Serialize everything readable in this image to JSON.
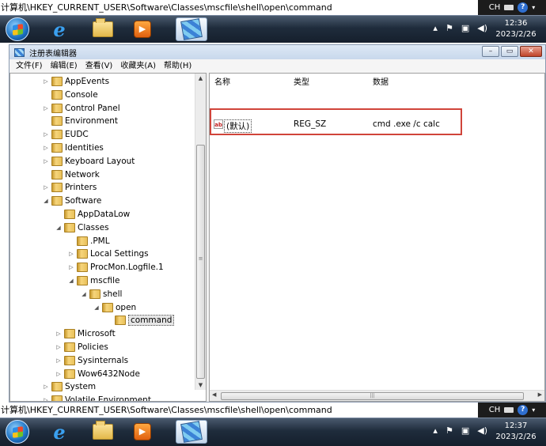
{
  "top": {
    "path": "计算机\\HKEY_CURRENT_USER\\Software\\Classes\\mscfile\\shell\\open\\command",
    "ime": "CH",
    "help": "?",
    "time": "12:36",
    "date": "2023/2/26"
  },
  "bottom": {
    "path": "计算机\\HKEY_CURRENT_USER\\Software\\Classes\\mscfile\\shell\\open\\command",
    "ime": "CH",
    "help": "?",
    "time": "12:37",
    "date": "2023/2/26"
  },
  "window": {
    "title": "注册表编辑器",
    "menu": [
      "文件(F)",
      "编辑(E)",
      "查看(V)",
      "收藏夹(A)",
      "帮助(H)"
    ]
  },
  "tree": [
    {
      "label": "AppEvents",
      "level": 0,
      "exp": "▷"
    },
    {
      "label": "Console",
      "level": 0,
      "exp": ""
    },
    {
      "label": "Control Panel",
      "level": 0,
      "exp": "▷"
    },
    {
      "label": "Environment",
      "level": 0,
      "exp": ""
    },
    {
      "label": "EUDC",
      "level": 0,
      "exp": "▷"
    },
    {
      "label": "Identities",
      "level": 0,
      "exp": "▷"
    },
    {
      "label": "Keyboard Layout",
      "level": 0,
      "exp": "▷"
    },
    {
      "label": "Network",
      "level": 0,
      "exp": ""
    },
    {
      "label": "Printers",
      "level": 0,
      "exp": "▷"
    },
    {
      "label": "Software",
      "level": 0,
      "exp": "◢"
    },
    {
      "label": "AppDataLow",
      "level": 1,
      "exp": ""
    },
    {
      "label": "Classes",
      "level": 1,
      "exp": "◢"
    },
    {
      "label": ".PML",
      "level": 2,
      "exp": ""
    },
    {
      "label": "Local Settings",
      "level": 2,
      "exp": "▷"
    },
    {
      "label": "ProcMon.Logfile.1",
      "level": 2,
      "exp": "▷"
    },
    {
      "label": "mscfile",
      "level": 2,
      "exp": "◢"
    },
    {
      "label": "shell",
      "level": 3,
      "exp": "◢"
    },
    {
      "label": "open",
      "level": 4,
      "exp": "◢"
    },
    {
      "label": "command",
      "level": 5,
      "exp": "",
      "selected": true
    },
    {
      "label": "Microsoft",
      "level": 1,
      "exp": "▷"
    },
    {
      "label": "Policies",
      "level": 1,
      "exp": "▷"
    },
    {
      "label": "Sysinternals",
      "level": 1,
      "exp": "▷"
    },
    {
      "label": "Wow6432Node",
      "level": 1,
      "exp": "▷"
    },
    {
      "label": "System",
      "level": 0,
      "exp": "▷"
    },
    {
      "label": "Volatile Environment",
      "level": 0,
      "exp": "▷"
    }
  ],
  "list": {
    "headers": {
      "name": "名称",
      "type": "类型",
      "data": "数据"
    },
    "rows": [
      {
        "icon": "ab",
        "name": "(默认)",
        "type": "REG_SZ",
        "data": "cmd .exe /c calc"
      }
    ]
  },
  "highlight_color": "#d0443a"
}
